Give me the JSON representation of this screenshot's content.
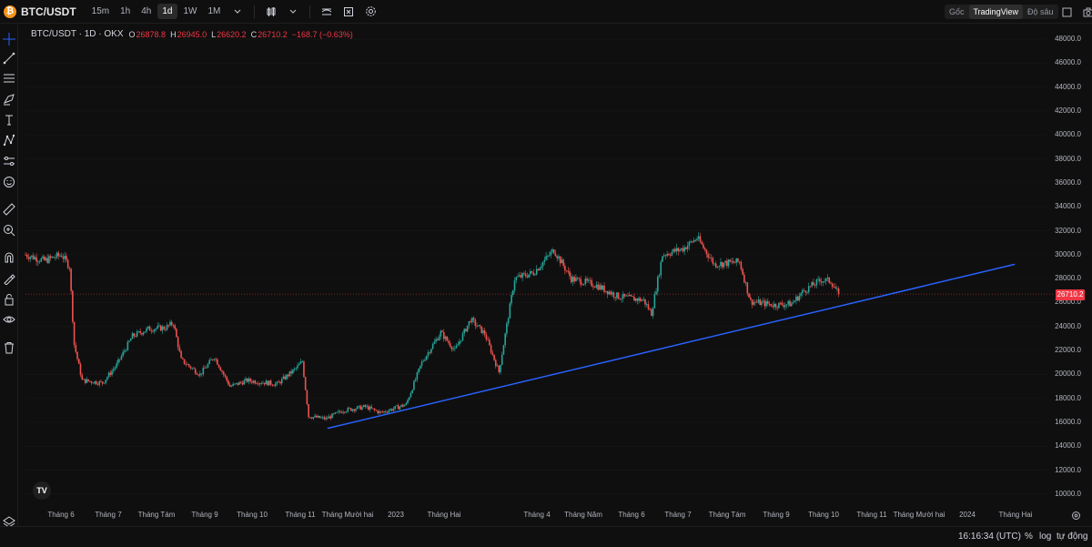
{
  "header": {
    "symbol": "BTC/USDT",
    "timeframes": [
      "15m",
      "1h",
      "4h",
      "1d",
      "1W",
      "1M"
    ],
    "active_timeframe": "1d",
    "view_tabs": [
      "Gốc",
      "TradingView",
      "Độ sâu"
    ],
    "active_view": "TradingView"
  },
  "legend": {
    "title": "BTC/USDT · 1D · OKX",
    "open_label": "O",
    "open": "26878.8",
    "high_label": "H",
    "high": "26945.0",
    "low_label": "L",
    "low": "26620.2",
    "close_label": "C",
    "close": "26710.2",
    "change": "−168.7 (−0.63%)"
  },
  "price_axis": [
    "48000.0",
    "46000.0",
    "44000.0",
    "42000.0",
    "40000.0",
    "38000.0",
    "36000.0",
    "34000.0",
    "32000.0",
    "30000.0",
    "28000.0",
    "26000.0",
    "24000.0",
    "22000.0",
    "20000.0",
    "18000.0",
    "16000.0",
    "14000.0",
    "12000.0",
    "10000.0"
  ],
  "last_price": "26710.2",
  "time_axis": [
    "Tháng 6",
    "Tháng 7",
    "Tháng Tám",
    "Tháng 9",
    "Tháng 10",
    "Tháng 11",
    "Tháng Mười hai",
    "2023",
    "Tháng Hai",
    "Tháng 4",
    "Tháng Năm",
    "Tháng 6",
    "Tháng 7",
    "Tháng Tám",
    "Tháng 9",
    "Tháng 10",
    "Tháng 11",
    "Tháng Mười hai",
    "2024",
    "Tháng Hai"
  ],
  "footer": {
    "clock": "16:16:34 (UTC)",
    "percent": "%",
    "log": "log",
    "auto": "tự động"
  },
  "tv_logo": "TV",
  "colors": {
    "up": "#26a69a",
    "down": "#ef5350",
    "trendline": "#2962ff",
    "last_price": "#f23645",
    "background": "#0f0f0f"
  },
  "chart_data": {
    "type": "candlestick",
    "symbol": "BTC/USDT",
    "interval": "1D",
    "exchange": "OKX",
    "y_range": [
      10000,
      48000
    ],
    "y_ticks": [
      10000,
      12000,
      14000,
      16000,
      18000,
      20000,
      22000,
      24000,
      26000,
      28000,
      30000,
      32000,
      34000,
      36000,
      38000,
      40000,
      42000,
      44000,
      46000,
      48000
    ],
    "x_range": [
      "2022-05-13",
      "2024-02-20"
    ],
    "last_price": 26710.2,
    "ohlc_last": {
      "open": 26878.8,
      "high": 26945.0,
      "low": 26620.2,
      "close": 26710.2
    },
    "close_path": [
      [
        "2022-05-13",
        30000
      ],
      [
        "2022-05-25",
        29500
      ],
      [
        "2022-06-05",
        30000
      ],
      [
        "2022-06-10",
        29000
      ],
      [
        "2022-06-13",
        22500
      ],
      [
        "2022-06-18",
        19500
      ],
      [
        "2022-07-01",
        19300
      ],
      [
        "2022-07-10",
        20800
      ],
      [
        "2022-07-20",
        23200
      ],
      [
        "2022-07-30",
        23800
      ],
      [
        "2022-08-10",
        23900
      ],
      [
        "2022-08-15",
        24300
      ],
      [
        "2022-08-20",
        21200
      ],
      [
        "2022-09-01",
        20000
      ],
      [
        "2022-09-10",
        21500
      ],
      [
        "2022-09-20",
        19000
      ],
      [
        "2022-10-01",
        19500
      ],
      [
        "2022-10-20",
        19200
      ],
      [
        "2022-11-01",
        20500
      ],
      [
        "2022-11-05",
        21100
      ],
      [
        "2022-11-09",
        16500
      ],
      [
        "2022-11-20",
        16300
      ],
      [
        "2022-12-01",
        17000
      ],
      [
        "2022-12-15",
        17300
      ],
      [
        "2022-12-25",
        16800
      ],
      [
        "2023-01-10",
        17500
      ],
      [
        "2023-01-20",
        21000
      ],
      [
        "2023-02-01",
        23500
      ],
      [
        "2023-02-10",
        22000
      ],
      [
        "2023-02-20",
        24600
      ],
      [
        "2023-03-01",
        23400
      ],
      [
        "2023-03-10",
        20200
      ],
      [
        "2023-03-20",
        28000
      ],
      [
        "2023-04-01",
        28500
      ],
      [
        "2023-04-14",
        30400
      ],
      [
        "2023-04-25",
        28000
      ],
      [
        "2023-05-10",
        27500
      ],
      [
        "2023-05-25",
        26500
      ],
      [
        "2023-06-10",
        26200
      ],
      [
        "2023-06-15",
        25100
      ],
      [
        "2023-06-22",
        30000
      ],
      [
        "2023-07-05",
        30500
      ],
      [
        "2023-07-14",
        31400
      ],
      [
        "2023-07-25",
        29200
      ],
      [
        "2023-08-10",
        29400
      ],
      [
        "2023-08-17",
        26100
      ],
      [
        "2023-09-01",
        25800
      ],
      [
        "2023-09-12",
        25900
      ],
      [
        "2023-09-20",
        27000
      ],
      [
        "2023-10-01",
        27900
      ],
      [
        "2023-10-07",
        27800
      ],
      [
        "2023-10-12",
        26710
      ]
    ],
    "trendline": {
      "start": [
        "2022-11-21",
        15500
      ],
      "end": [
        "2024-02-01",
        29200
      ]
    }
  }
}
